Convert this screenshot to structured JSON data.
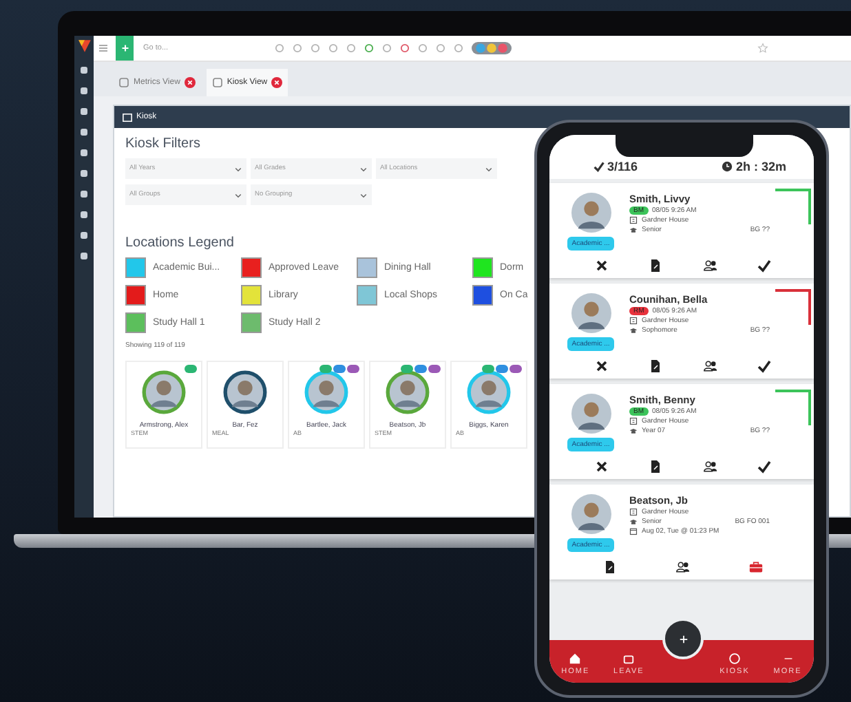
{
  "laptop": {
    "search": {
      "placeholder": "Go to..."
    },
    "tabs": [
      {
        "label": "Metrics View",
        "selected": false
      },
      {
        "label": "Kiosk View",
        "selected": true
      }
    ],
    "panel": {
      "title": "Kiosk",
      "filters_title": "Kiosk Filters",
      "filters": [
        {
          "value": "All Years"
        },
        {
          "value": "All Grades"
        },
        {
          "value": "All Locations"
        },
        {
          "value": "All Groups"
        },
        {
          "value": "No Grouping"
        }
      ],
      "legend_title": "Locations Legend",
      "legend": [
        {
          "label": "Academic Bui...",
          "color": "#22c7ea"
        },
        {
          "label": "Approved Leave",
          "color": "#e8201f"
        },
        {
          "label": "Dining Hall",
          "color": "#a9c3db"
        },
        {
          "label": "Dorm",
          "color": "#1fe51f"
        },
        {
          "label": "Home",
          "color": "#e31b1b"
        },
        {
          "label": "Library",
          "color": "#e3e33a"
        },
        {
          "label": "Local Shops",
          "color": "#7fc6d6"
        },
        {
          "label": "On Ca",
          "color": "#1e4fe0"
        },
        {
          "label": "Study Hall 1",
          "color": "#5cbf5c"
        },
        {
          "label": "Study Hall 2",
          "color": "#6dbb6d"
        }
      ],
      "count": "Showing 119 of 119",
      "students": [
        {
          "name": "Armstrong, Alex",
          "note": "STEM",
          "color": "#5aa83c",
          "tags": [
            {
              "color": "#2bb673"
            }
          ]
        },
        {
          "name": "Bar, Fez",
          "note": "MEAL",
          "color": "#1f4f6b"
        },
        {
          "name": "Bartlee, Jack",
          "note": "AB",
          "color": "#22c7ea",
          "tags": [
            {
              "color": "#2bb673"
            },
            {
              "color": "#2f8fe0"
            },
            {
              "color": "#9b59b6"
            }
          ]
        },
        {
          "name": "Beatson, Jb",
          "note": "STEM",
          "color": "#5aa83c",
          "tags": [
            {
              "color": "#2bb673"
            },
            {
              "color": "#2f8fe0"
            },
            {
              "color": "#9b59b6"
            }
          ]
        },
        {
          "name": "Biggs, Karen",
          "note": "AB",
          "color": "#22c7ea",
          "tags": [
            {
              "color": "#2bb673"
            },
            {
              "color": "#2f8fe0"
            },
            {
              "color": "#9b59b6"
            }
          ]
        }
      ]
    }
  },
  "phone": {
    "progress": "3/116",
    "timer": "2h : 32m",
    "cards": [
      {
        "kind": "pending",
        "name": "Smith, Livvy",
        "badge": {
          "text": "BM",
          "color": "#3cc45a"
        },
        "time": "08/05 9:26 AM",
        "house": "Gardner House",
        "year": "Senior",
        "code": "BG ??",
        "chip": "Academic ...",
        "accent": {
          "color": "#3cc45a"
        }
      },
      {
        "kind": "pending",
        "name": "Counihan, Bella",
        "badge": {
          "text": "RM",
          "color": "#e8323c"
        },
        "time": "08/05 9:26 AM",
        "house": "Gardner House",
        "year": "Sophomore",
        "code": "BG ??",
        "chip": "Academic ...",
        "accent": {
          "color": "#d9303a"
        }
      },
      {
        "kind": "pending",
        "name": "Smith, Benny",
        "badge": {
          "text": "BM",
          "color": "#3cc45a"
        },
        "time": "08/05 9:26 AM",
        "house": "Gardner House",
        "year": "Year 07",
        "code": "BG ??",
        "chip": "Academic ...",
        "accent": {
          "color": "#3cc45a"
        }
      },
      {
        "kind": "out",
        "name": "Beatson, Jb",
        "house": "Gardner House",
        "year": "Senior",
        "code": "BG FO 001",
        "date": "Aug 02, Tue @ 01:23 PM",
        "chip": "Academic ..."
      }
    ],
    "nav": [
      {
        "kind": "home",
        "label": "HOME"
      },
      {
        "kind": "leave",
        "label": "LEAVE"
      },
      {
        "kind": "kiosk",
        "label": "KIOSK"
      },
      {
        "kind": "more",
        "label": "MORE"
      }
    ]
  }
}
